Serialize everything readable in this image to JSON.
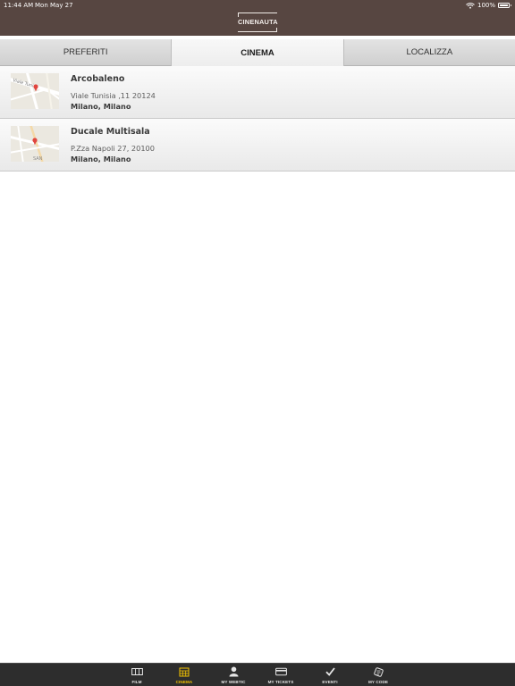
{
  "status_bar": {
    "time": "11:44 AM",
    "date": "Mon May 27",
    "battery": "100%"
  },
  "header": {
    "logo_text": "CINENAUTA"
  },
  "tabs": [
    {
      "label": "PREFERITI",
      "active": false
    },
    {
      "label": "CINEMA",
      "active": true
    },
    {
      "label": "LOCALIZZA",
      "active": false
    }
  ],
  "cinemas": [
    {
      "name": "Arcobaleno",
      "address": "Viale Tunisia ,11 20124",
      "city": "Milano, Milano",
      "map_label": "Viale Tuni"
    },
    {
      "name": "Ducale Multisala",
      "address": "P.Zza Napoli 27, 20100",
      "city": "Milano, Milano",
      "map_label": "SAN"
    }
  ],
  "bottom_nav": [
    {
      "label": "FILM",
      "icon": "film-icon",
      "active": false
    },
    {
      "label": "CINEMA",
      "icon": "cinema-icon",
      "active": true
    },
    {
      "label": "MY WEBTIC",
      "icon": "user-icon",
      "active": false
    },
    {
      "label": "MY TICKETS",
      "icon": "ticket-card-icon",
      "active": false
    },
    {
      "label": "EVENTI",
      "icon": "checkmark-icon",
      "active": false
    },
    {
      "label": "MY CODE",
      "icon": "code-icon",
      "active": false
    }
  ],
  "colors": {
    "header_bg": "#574641",
    "nav_bg": "#2d2d2d",
    "nav_active": "#f2c200",
    "map_pin": "#e0463f"
  }
}
